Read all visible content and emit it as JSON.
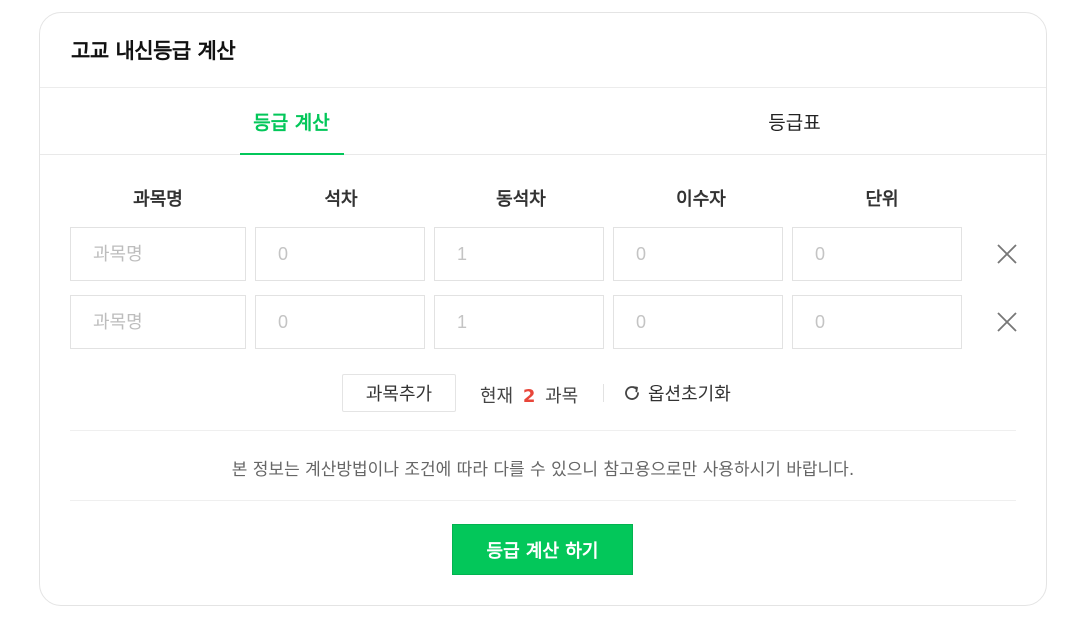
{
  "card": {
    "title": "고교 내신등급 계산"
  },
  "tabs": [
    {
      "label": "등급 계산",
      "active": true
    },
    {
      "label": "등급표",
      "active": false
    }
  ],
  "columns": [
    "과목명",
    "석차",
    "동석차",
    "이수자",
    "단위"
  ],
  "rows": [
    {
      "subject_placeholder": "과목명",
      "rank_placeholder": "0",
      "tie_placeholder": "1",
      "students_placeholder": "0",
      "units_placeholder": "0"
    },
    {
      "subject_placeholder": "과목명",
      "rank_placeholder": "0",
      "tie_placeholder": "1",
      "students_placeholder": "0",
      "units_placeholder": "0"
    }
  ],
  "controls": {
    "add_label": "과목추가",
    "count_prefix": "현재",
    "count_value": "2",
    "count_suffix": "과목",
    "reset_label": "옵션초기화"
  },
  "notice": "본 정보는 계산방법이나 조건에 따라 다를 수 있으니 참고용으로만 사용하시기 바랍니다.",
  "submit_label": "등급 계산 하기",
  "colors": {
    "accent": "#03c75a",
    "count": "#e8463a",
    "border": "#e2e2e2"
  },
  "icons": {
    "remove": "close-icon",
    "reset": "refresh-icon"
  }
}
